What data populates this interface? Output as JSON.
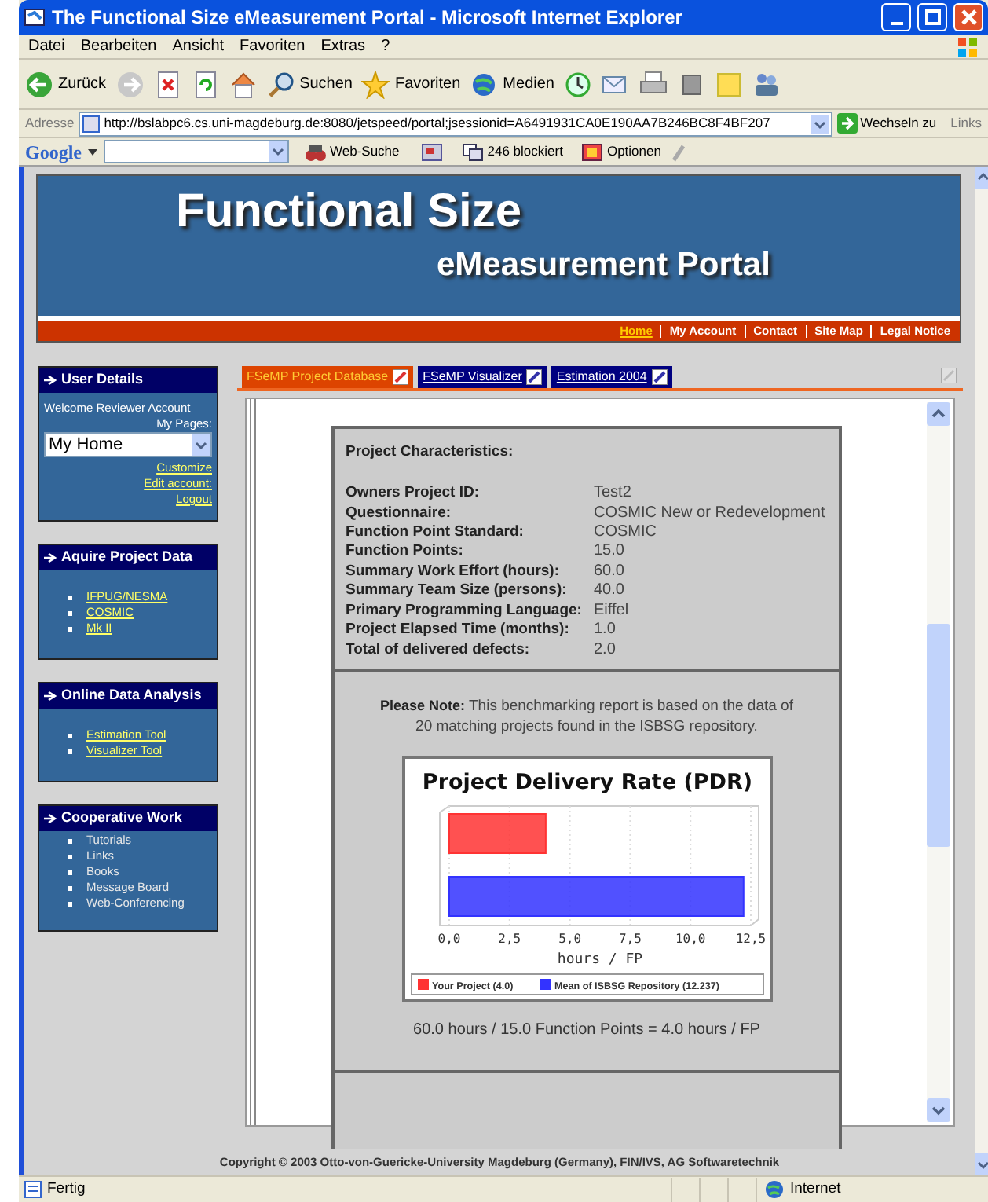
{
  "window": {
    "title": "The Functional Size eMeasurement Portal - Microsoft Internet Explorer"
  },
  "menu_bar": [
    "Datei",
    "Bearbeiten",
    "Ansicht",
    "Favoriten",
    "Extras",
    "?"
  ],
  "toolbar": [
    {
      "kind": "back",
      "label": "Zurück"
    },
    {
      "kind": "forward"
    },
    {
      "kind": "stop"
    },
    {
      "kind": "refresh"
    },
    {
      "kind": "home"
    },
    {
      "kind": "search",
      "label": "Suchen"
    },
    {
      "kind": "favorites",
      "label": "Favoriten"
    },
    {
      "kind": "media",
      "label": "Medien"
    },
    {
      "kind": "history"
    },
    {
      "kind": "mail"
    },
    {
      "kind": "print"
    },
    {
      "kind": "edit"
    },
    {
      "kind": "note"
    },
    {
      "kind": "messenger"
    }
  ],
  "address_bar": {
    "label": "Adresse",
    "value": "http://bslabpc6.cs.uni-magdeburg.de:8080/jetspeed/portal;jsessionid=A6491931CA0E190AA7B246BC8F4BF207",
    "go_button": "Wechseln zu",
    "links": "Links"
  },
  "google_toolbar": {
    "logo": "Google",
    "search_button": "Web-Suche",
    "blocked": "246 blockiert",
    "options": "Optionen"
  },
  "header": {
    "title": "Functional Size",
    "subtitle": "eMeasurement Portal",
    "nav": [
      {
        "label": "Home",
        "selected": true
      },
      {
        "label": "My Account",
        "selected": false
      },
      {
        "label": "Contact",
        "selected": false
      },
      {
        "label": "Site Map",
        "selected": false
      },
      {
        "label": "Legal Notice",
        "selected": false
      }
    ]
  },
  "sidebar": [
    {
      "kind": "user",
      "title": "User Details",
      "welcome": "Welcome Reviewer Account",
      "pages_label": "My Pages:",
      "select_value": "My Home",
      "links": [
        "Customize",
        "Edit account:",
        "Logout"
      ]
    },
    {
      "kind": "links",
      "title": "Aquire Project Data",
      "items": [
        "IFPUG/NESMA",
        "COSMIC",
        "Mk II"
      ]
    },
    {
      "kind": "links",
      "title": "Online Data Analysis",
      "items": [
        "Estimation Tool",
        "Visualizer Tool"
      ]
    },
    {
      "kind": "list",
      "title": "Cooperative Work",
      "items": [
        "Tutorials",
        "Links",
        "Books",
        "Message Board",
        "Web-Conferencing"
      ]
    }
  ],
  "tabs": [
    {
      "label": "FSeMP Project Database",
      "selected": true
    },
    {
      "label": "FSeMP Visualizer",
      "selected": false
    },
    {
      "label": "Estimation 2004",
      "selected": false
    }
  ],
  "project_characteristics": {
    "heading": "Project Characteristics:",
    "fields": [
      {
        "label": "Owners Project ID:",
        "value": "Test2"
      },
      {
        "label": "Questionnaire:",
        "value": "COSMIC New or Redevelopment"
      },
      {
        "label": "Function Point Standard:",
        "value": "COSMIC"
      },
      {
        "label": "Function Points:",
        "value": "15.0"
      },
      {
        "label": "Summary Work Effort (hours):",
        "value": "60.0"
      },
      {
        "label": "Summary Team Size (persons):",
        "value": "40.0"
      },
      {
        "label": "Primary Programming Language:",
        "value": "Eiffel"
      },
      {
        "label": "Project Elapsed Time (months):",
        "value": "1.0"
      },
      {
        "label": "Total of delivered defects:",
        "value": "2.0"
      }
    ]
  },
  "note": "**Please Note:** This benchmarking report is based on the data of 20 matching projects found in the ISBSG repository.",
  "chart_data": {
    "type": "bar",
    "orientation": "horizontal",
    "stacked": false,
    "grid": true,
    "legend": "bottom",
    "title": "Project Delivery Rate (PDR)",
    "xlabel": "hours / FP",
    "xlim": [
      0,
      12.5
    ],
    "xticks": [
      {
        "value": 0,
        "label": "0,0"
      },
      {
        "value": 2.5,
        "label": "2,5"
      },
      {
        "value": 5,
        "label": "5,0"
      },
      {
        "value": 7.5,
        "label": "7,5"
      },
      {
        "value": 10,
        "label": "10,0"
      },
      {
        "value": 12.5,
        "label": "12,5"
      }
    ],
    "series": [
      {
        "name": "Your Project (4.0)",
        "color": "#ff3333",
        "values": [
          4.0,
          null
        ]
      },
      {
        "name": "Mean of ISBSG Repository (12.237)",
        "color": "#3333ff",
        "values": [
          null,
          12.2
        ]
      }
    ]
  },
  "formula": "60.0 hours / 15.0 Function Points = 4.0 hours / FP",
  "copyright": "Copyright © 2003 Otto-von-Guericke-University Magdeburg (Germany), FIN/IVS, AG Softwaretechnik",
  "status_bar": {
    "text": "Fertig",
    "zone": "Internet"
  }
}
